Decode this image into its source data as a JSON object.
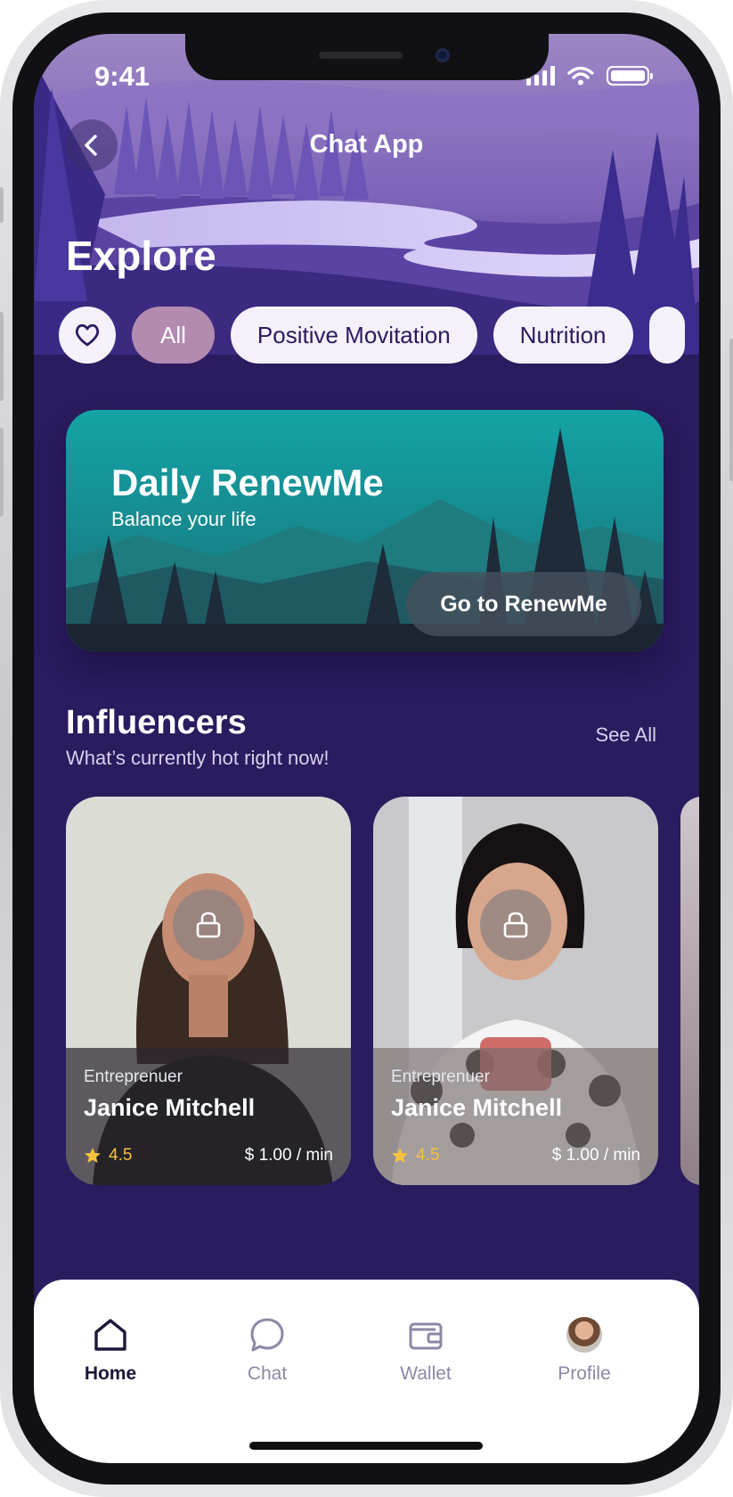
{
  "status": {
    "time": "9:41"
  },
  "header": {
    "title": "Chat App",
    "back_icon": "chevron-left-icon"
  },
  "explore": {
    "heading": "Explore"
  },
  "filters": {
    "favorite_icon": "heart-icon",
    "items": [
      {
        "label": "All",
        "active": true
      },
      {
        "label": "Positive Movitation",
        "active": false
      },
      {
        "label": "Nutrition",
        "active": false
      }
    ]
  },
  "banner": {
    "title": "Daily RenewMe",
    "subtitle": "Balance your life",
    "button_label": "Go to RenewMe"
  },
  "influencers": {
    "title": "Influencers",
    "subtitle": "What’s currently hot right now!",
    "see_all": "See All",
    "cards": [
      {
        "role": "Entreprenuer",
        "name": "Janice Mitchell",
        "rating": "4.5",
        "price": "$ 1.00 / min",
        "locked": true
      },
      {
        "role": "Entreprenuer",
        "name": "Janice Mitchell",
        "rating": "4.5",
        "price": "$ 1.00 / min",
        "locked": true
      }
    ]
  },
  "nav": {
    "items": [
      {
        "label": "Home",
        "icon": "home-icon",
        "active": true
      },
      {
        "label": "Chat",
        "icon": "chat-bubble-icon",
        "active": false
      },
      {
        "label": "Wallet",
        "icon": "wallet-icon",
        "active": false
      },
      {
        "label": "Profile",
        "icon": "avatar",
        "active": false
      }
    ]
  },
  "colors": {
    "background": "#2b1b5f",
    "chip_active": "#b38ab0",
    "chip": "#f4f1fa",
    "banner": "#1aa3a3",
    "rating": "#f6c23e",
    "nav_active": "#1b1838",
    "nav_inactive": "#8b88a6"
  }
}
